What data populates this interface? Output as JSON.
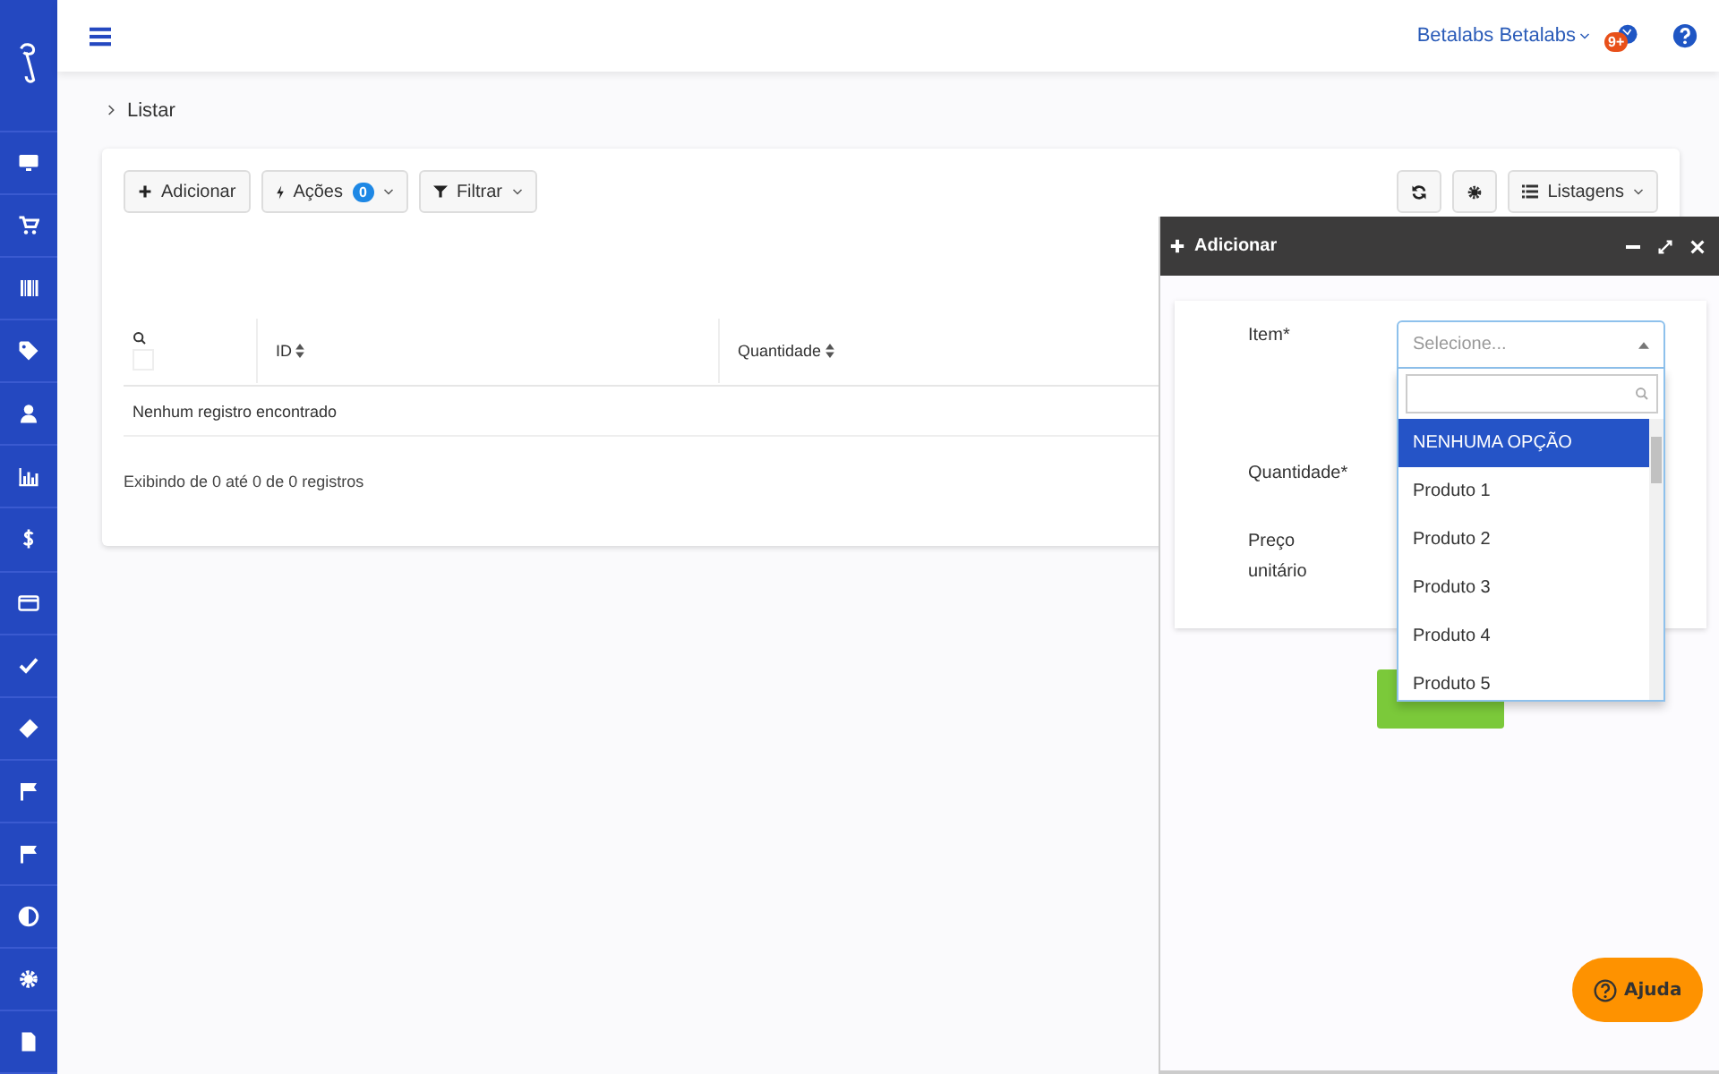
{
  "topbar": {
    "user": "Betalabs Betalabs",
    "notification_badge": "9+"
  },
  "breadcrumb": "Listar",
  "toolbar": {
    "buttons": [
      {
        "kind": "add",
        "label": "Adicionar"
      },
      {
        "kind": "actions",
        "label": "Ações",
        "count": "0"
      },
      {
        "kind": "filter",
        "label": "Filtrar"
      }
    ],
    "right_buttons": [
      {
        "kind": "refresh"
      },
      {
        "kind": "settings"
      },
      {
        "kind": "listings",
        "label": "Listagens"
      }
    ]
  },
  "table": {
    "select_all_checked": false,
    "columns": [
      "ID",
      "Quantidade"
    ],
    "empty_message": "Nenhum registro encontrado",
    "footer": "Exibindo de 0 até 0 de 0 registros"
  },
  "panel": {
    "title": "Adicionar",
    "fields": [
      {
        "label": "Item*"
      },
      {
        "label": "Quantidade*"
      },
      {
        "label": "Preço unitário"
      }
    ],
    "select": {
      "placeholder": "Selecione...",
      "expanded": true,
      "options": [
        {
          "label": "NENHUMA OPÇÃO",
          "selected": true
        },
        {
          "label": "Produto 1",
          "selected": false
        },
        {
          "label": "Produto 2",
          "selected": false
        },
        {
          "label": "Produto 3",
          "selected": false
        },
        {
          "label": "Produto 4",
          "selected": false
        },
        {
          "label": "Produto 5",
          "selected": false
        }
      ]
    }
  },
  "help_button": "Ajuda"
}
